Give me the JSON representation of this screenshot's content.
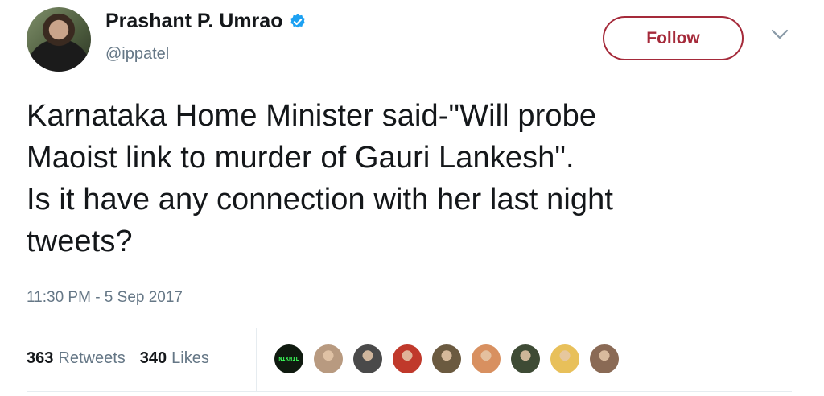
{
  "user": {
    "name": "Prashant P. Umrao",
    "handle": "@ippatel",
    "verified_icon": "verified-badge-icon",
    "avatar": "profile-photo"
  },
  "actions": {
    "follow_label": "Follow",
    "more_icon": "chevron-down-icon"
  },
  "tweet": {
    "lines": [
      "Karnataka Home Minister said-\"Will probe",
      "Maoist link to murder of Gauri Lankesh\".",
      "Is it have any connection with her last night",
      "tweets?"
    ],
    "timestamp": "11:30 PM - 5 Sep 2017"
  },
  "stats": {
    "retweets_count": "363",
    "retweets_label": "Retweets",
    "likes_count": "340",
    "likes_label": "Likes"
  },
  "likers": [
    {
      "color": "#0f1a0f",
      "label": "NIKHIL"
    },
    {
      "color": "#b89a80",
      "label": ""
    },
    {
      "color": "#4a4a4a",
      "label": ""
    },
    {
      "color": "#c0392b",
      "label": ""
    },
    {
      "color": "#6b5a40",
      "label": ""
    },
    {
      "color": "#d89060",
      "label": ""
    },
    {
      "color": "#3e4b35",
      "label": ""
    },
    {
      "color": "#e8c05a",
      "label": ""
    },
    {
      "color": "#8a6a55",
      "label": ""
    }
  ],
  "colors": {
    "accent": "#a52a3a",
    "text": "#14171a",
    "muted": "#657786",
    "verified": "#1da1f2"
  }
}
